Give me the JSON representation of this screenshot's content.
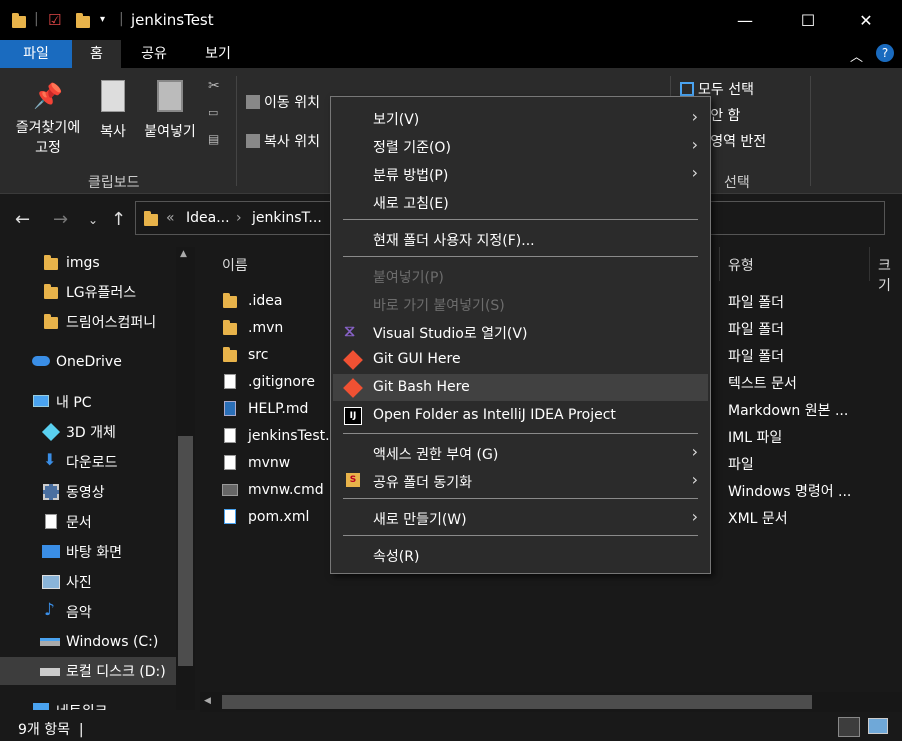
{
  "window": {
    "title": "jenkinsTest",
    "minimize_glyph": "—",
    "maximize_glyph": "☐",
    "close_glyph": "✕"
  },
  "ribbon_tabs": {
    "file": "파일",
    "home": "홈",
    "share": "공유",
    "view": "보기"
  },
  "ribbon": {
    "pin_label": "즐겨찾기에\n고정",
    "copy_label": "복사",
    "paste_label": "붙여넣기",
    "clipboard_group": "클립보드",
    "move_to": "이동 위치",
    "copy_to": "복사 위치",
    "select_all": "모두 선택",
    "select_none": "선택 안 함",
    "invert_selection": "선택 영역 반전",
    "select_group": "선택"
  },
  "address": {
    "crumb_prefix": "«",
    "crumbs": [
      "Idea...",
      "jenkinsT..."
    ],
    "separator": "›"
  },
  "nav_pane": {
    "items": [
      {
        "label": "imgs",
        "icon": "folder-icon"
      },
      {
        "label": "LG유플러스",
        "icon": "folder-icon"
      },
      {
        "label": "드림어스컴퍼니",
        "icon": "folder-icon"
      },
      {
        "label": "OneDrive",
        "icon": "onedrive-icon"
      },
      {
        "label": "내 PC",
        "icon": "pc-icon"
      },
      {
        "label": "3D 개체",
        "icon": "3d-objects-icon"
      },
      {
        "label": "다운로드",
        "icon": "download-icon"
      },
      {
        "label": "동영상",
        "icon": "video-icon"
      },
      {
        "label": "문서",
        "icon": "documents-icon"
      },
      {
        "label": "바탕 화면",
        "icon": "desktop-icon"
      },
      {
        "label": "사진",
        "icon": "pictures-icon"
      },
      {
        "label": "음악",
        "icon": "music-icon"
      },
      {
        "label": "Windows (C:)",
        "icon": "drive-icon"
      },
      {
        "label": "로컬 디스크 (D:)",
        "icon": "drive-icon"
      },
      {
        "label": "네트워크",
        "icon": "network-icon"
      }
    ]
  },
  "file_list": {
    "col_name": "이름",
    "col_type": "유형",
    "col_size": "크기",
    "rows": [
      {
        "name": ".idea",
        "type": "파일 폴더"
      },
      {
        "name": ".mvn",
        "type": "파일 폴더"
      },
      {
        "name": "src",
        "type": "파일 폴더"
      },
      {
        "name": ".gitignore",
        "type": "텍스트 문서"
      },
      {
        "name": "HELP.md",
        "type": "Markdown 원본 ..."
      },
      {
        "name": "jenkinsTest.i",
        "type": "IML 파일"
      },
      {
        "name": "mvnw",
        "type": "파일"
      },
      {
        "name": "mvnw.cmd",
        "type": "Windows 명령어 ..."
      },
      {
        "name": "pom.xml",
        "type": "XML 문서"
      }
    ]
  },
  "status": {
    "count": "9개 항목",
    "divider": "|"
  },
  "context_menu": {
    "items": [
      {
        "label": "보기(V)",
        "submenu": true
      },
      {
        "label": "정렬 기준(O)",
        "submenu": true
      },
      {
        "label": "분류 방법(P)",
        "submenu": true
      },
      {
        "label": "새로 고침(E)"
      },
      {
        "label": "현재 폴더 사용자 지정(F)..."
      },
      {
        "label": "붙여넣기(P)",
        "disabled": true
      },
      {
        "label": "바로 가기 붙여넣기(S)",
        "disabled": true
      },
      {
        "label": "Visual Studio로 열기(V)",
        "icon": "visual-studio-icon"
      },
      {
        "label": "Git GUI Here",
        "icon": "git-icon"
      },
      {
        "label": "Git Bash Here",
        "icon": "git-icon",
        "highlighted": true
      },
      {
        "label": "Open Folder as IntelliJ IDEA Project",
        "icon": "intellij-icon"
      },
      {
        "label": "액세스 권한 부여 (G)",
        "submenu": true
      },
      {
        "label": "공유 폴더 동기화",
        "submenu": true,
        "icon": "sync-icon"
      },
      {
        "label": "새로 만들기(W)",
        "submenu": true
      },
      {
        "label": "속성(R)"
      }
    ]
  },
  "colors": {
    "accent_file_tab": "#1a6bbf",
    "folder": "#e8b34a",
    "git": "#f05133",
    "visual_studio": "#8661c5"
  }
}
